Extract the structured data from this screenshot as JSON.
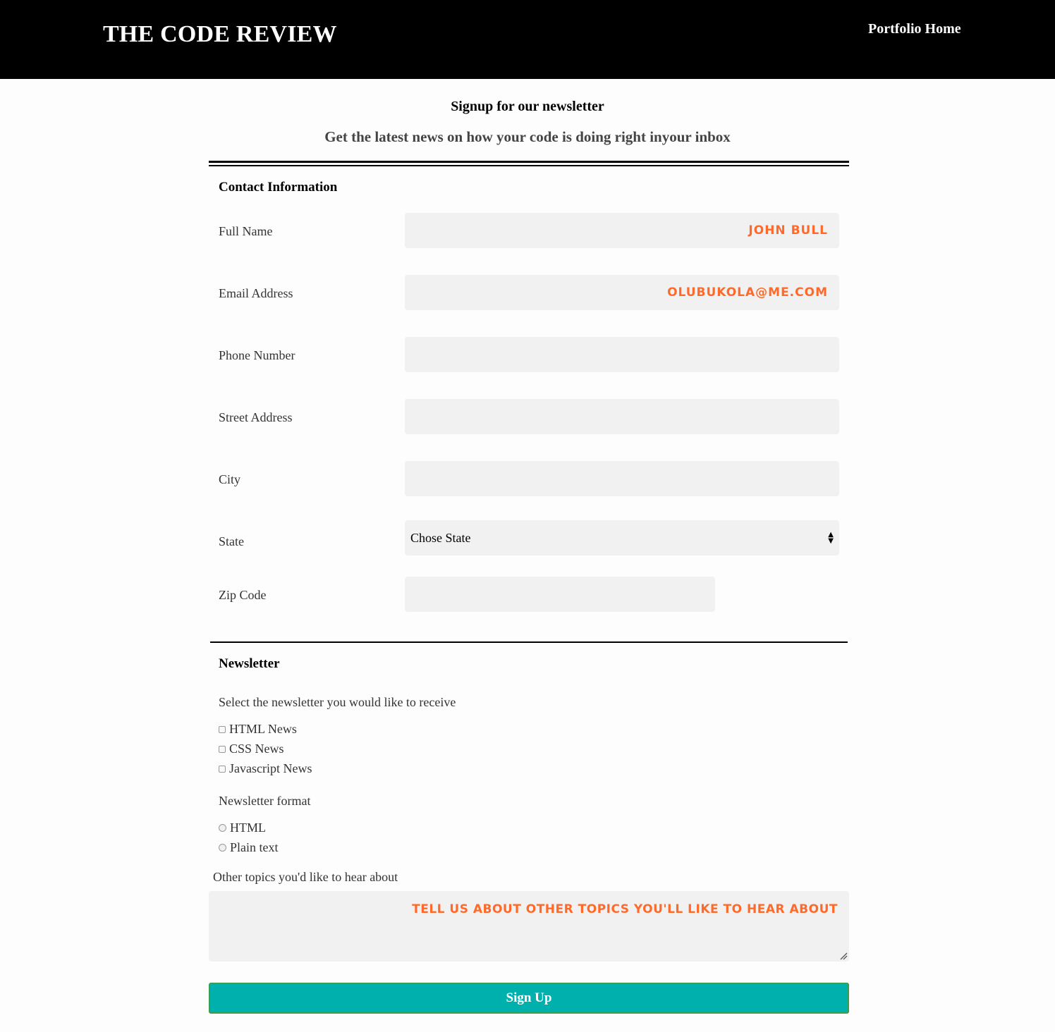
{
  "header": {
    "brand": "THE CODE REVIEW",
    "nav_link": "Portfolio Home"
  },
  "intro": {
    "title": "Signup for our newsletter",
    "subtitle": "Get the latest news on how your code is doing right inyour inbox"
  },
  "contact": {
    "section_title": "Contact Information",
    "fields": [
      {
        "label": "Full Name",
        "value": "John Bull"
      },
      {
        "label": "Email Address",
        "value": "olubukola@me.com"
      },
      {
        "label": "Phone Number",
        "value": ""
      },
      {
        "label": "Street Address",
        "value": ""
      },
      {
        "label": "City",
        "value": ""
      }
    ],
    "state": {
      "label": "State",
      "selected": "Chose State"
    },
    "zip": {
      "label": "Zip Code",
      "value": ""
    }
  },
  "newsletter": {
    "section_title": "Newsletter",
    "select_prompt": "Select the newsletter you would like to receive",
    "options": [
      "HTML News",
      "CSS News",
      "Javascript News"
    ],
    "format_label": "Newsletter format",
    "formats": [
      "HTML",
      "Plain text"
    ],
    "topics_label": "Other topics you'd like to hear about",
    "topics_value": "Tell us about other topics you'll like to hear about"
  },
  "submit_label": "Sign Up",
  "colors": {
    "header_bg": "#000000",
    "input_bg": "#f1f1f1",
    "input_text": "#ff6a2b",
    "button_bg": "#00b0ad"
  },
  "icons": {
    "select_arrows": "updown-arrows-icon",
    "resize": "resize-handle-icon"
  }
}
